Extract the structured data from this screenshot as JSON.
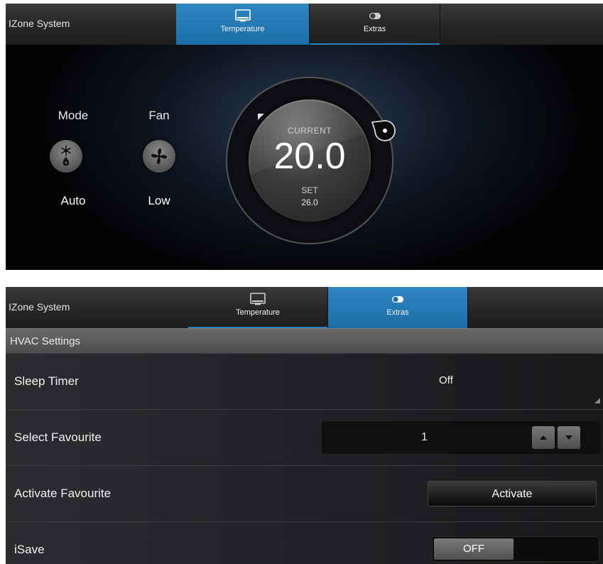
{
  "top": {
    "app_title": "IZone System",
    "tabs": [
      {
        "label": "Temperature",
        "icon": "monitor-icon",
        "active": true
      },
      {
        "label": "Extras",
        "icon": "toggle-icon",
        "active": false
      }
    ],
    "mode": {
      "label": "Mode",
      "value": "Auto",
      "icon": "snowflake-flame-icon"
    },
    "fan": {
      "label": "Fan",
      "value": "Low",
      "icon": "fan-icon"
    },
    "dial": {
      "current_label": "CURRENT",
      "current_temp": "20.0",
      "set_label": "SET",
      "set_temp": "26.0"
    }
  },
  "bottom": {
    "app_title": "IZone System",
    "tabs": [
      {
        "label": "Temperature",
        "icon": "monitor-icon",
        "active": false
      },
      {
        "label": "Extras",
        "icon": "toggle-icon",
        "active": true
      }
    ],
    "section_title": "HVAC Settings",
    "rows": {
      "sleep_timer": {
        "label": "Sleep Timer",
        "value": "Off"
      },
      "select_favourite": {
        "label": "Select Favourite",
        "value": "1"
      },
      "activate_favourite": {
        "label": "Activate Favourite",
        "button": "Activate"
      },
      "isave": {
        "label": "iSave",
        "toggle": "OFF"
      }
    }
  },
  "colors": {
    "accent": "#2a82bd",
    "background": "#050505"
  }
}
